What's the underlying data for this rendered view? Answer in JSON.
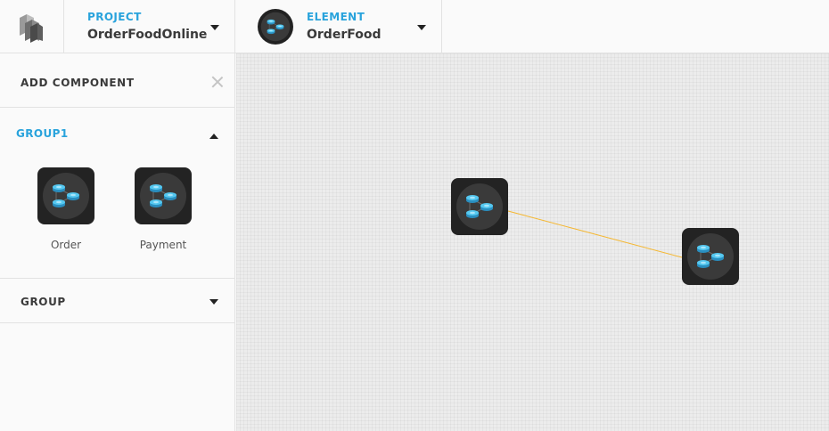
{
  "header": {
    "logo_icon": "stacked-cubes-logo",
    "project": {
      "label": "PROJECT",
      "value": "OrderFoodOnline"
    },
    "element": {
      "label": "ELEMENT",
      "value": "OrderFood",
      "icon": "database-cluster-icon"
    }
  },
  "sidebar": {
    "title": "ADD COMPONENT",
    "groups": [
      {
        "title": "GROUP1",
        "expanded": true,
        "components": [
          {
            "label": "Order",
            "icon": "database-cluster-icon"
          },
          {
            "label": "Payment",
            "icon": "database-cluster-icon"
          }
        ]
      },
      {
        "title": "GROUP",
        "expanded": false,
        "components": []
      }
    ]
  },
  "canvas": {
    "nodes": [
      {
        "icon": "database-cluster-icon"
      },
      {
        "icon": "database-cluster-icon"
      }
    ],
    "link_color": "#f5b730"
  },
  "colors": {
    "accent": "#29a3dc",
    "node_bg": "#232323",
    "db_cyan": "#4cc3ea"
  }
}
